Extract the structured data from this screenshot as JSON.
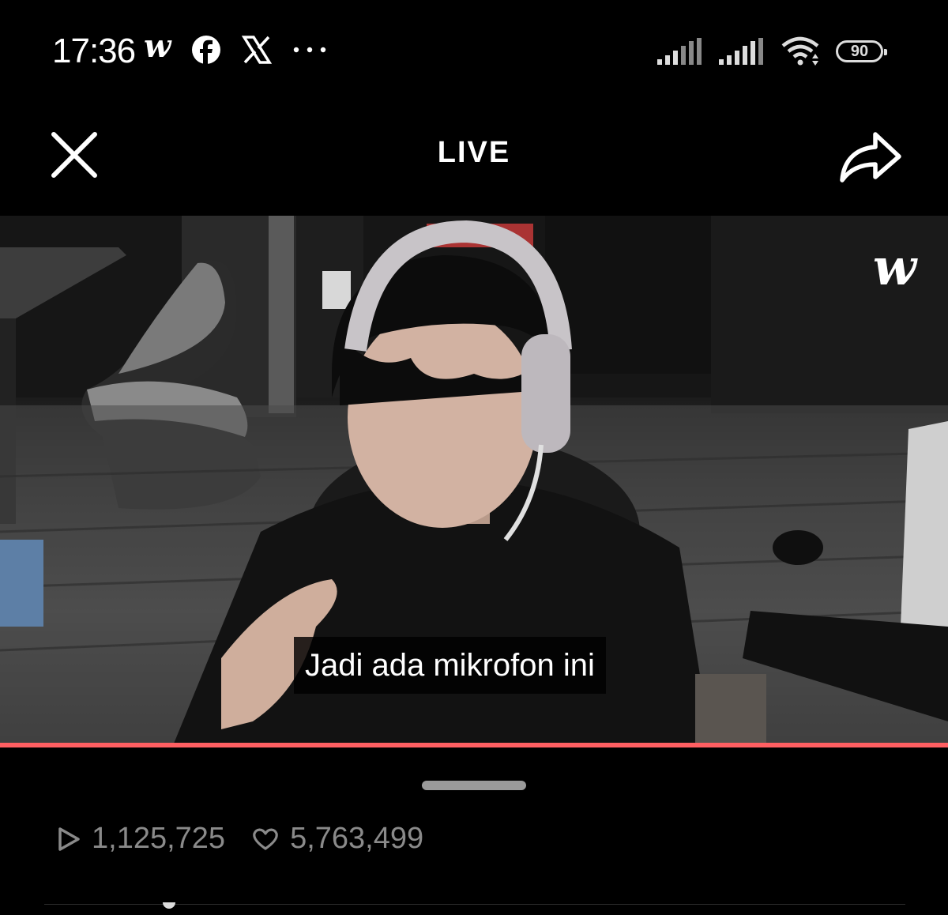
{
  "status_bar": {
    "time": "17:36",
    "app_icons": [
      "weverse-icon",
      "facebook-icon",
      "x-icon",
      "more-dots-icon"
    ],
    "battery": "90"
  },
  "header": {
    "title": "LIVE"
  },
  "video": {
    "watermark": "w",
    "caption": "Jadi ada mikrofon ini",
    "progress": 1.0,
    "accent_color": "#ff5f62"
  },
  "stats": {
    "views": "1,125,725",
    "likes": "5,763,499"
  }
}
